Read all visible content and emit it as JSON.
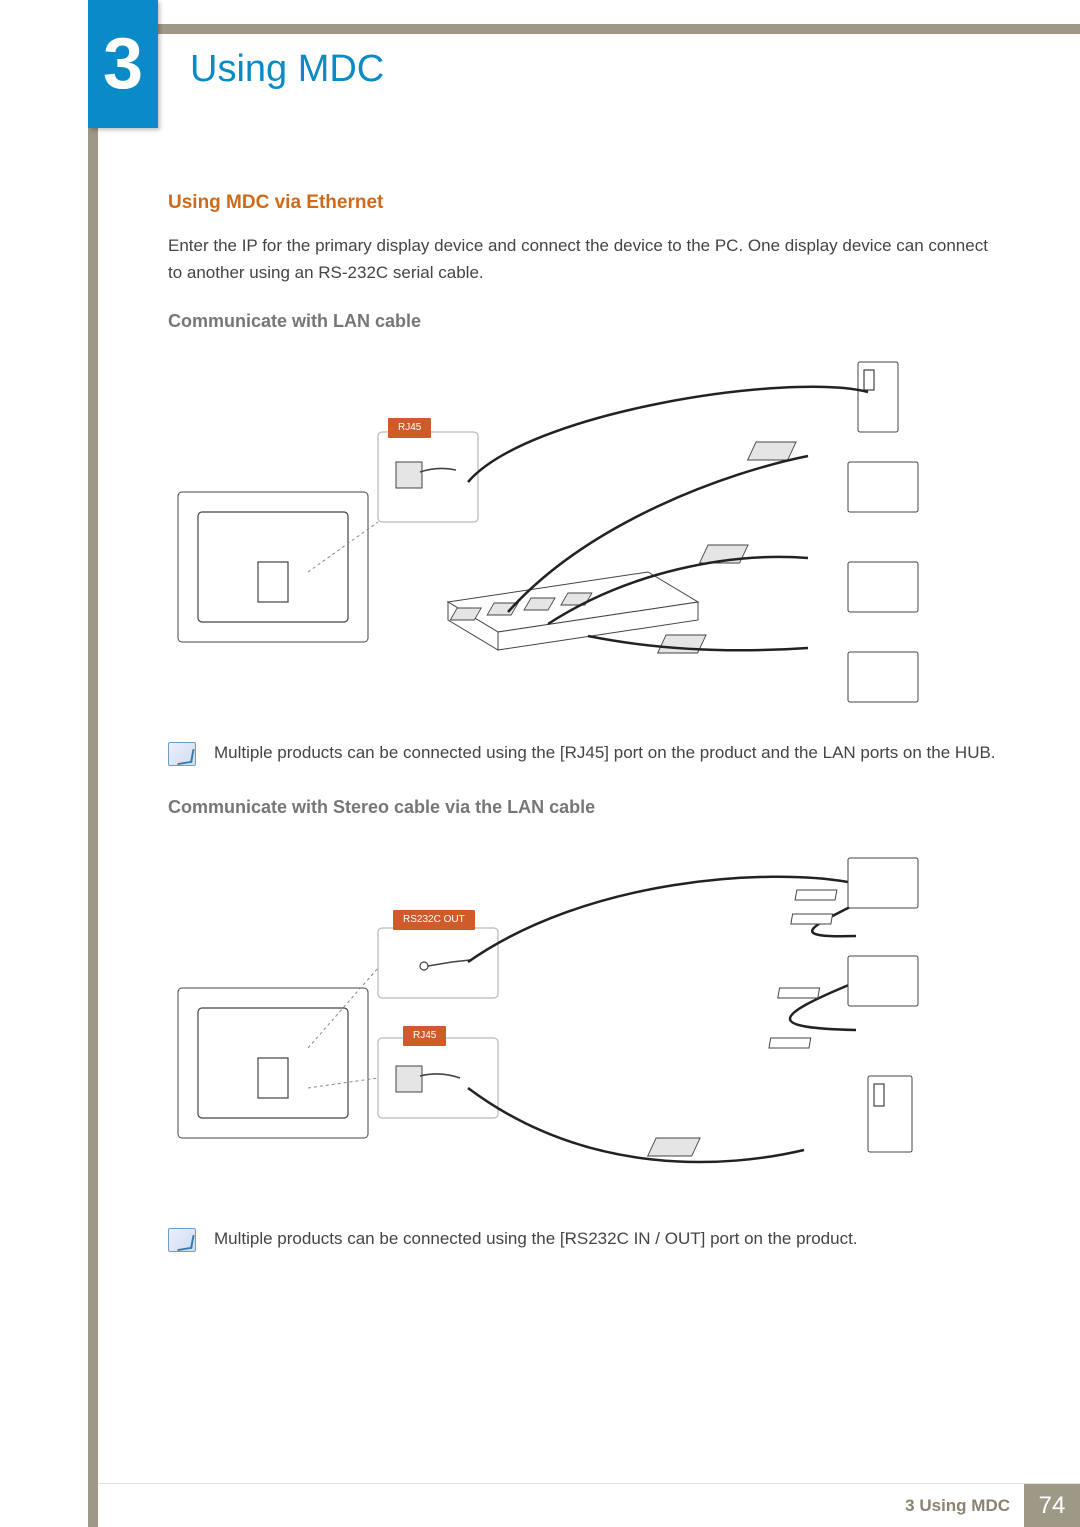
{
  "chapter": {
    "number": "3",
    "title": "Using MDC"
  },
  "section": {
    "heading": "Using MDC via Ethernet",
    "intro": "Enter the IP for the primary display device and connect the device to the PC. One display device can connect to another using an RS-232C serial cable.",
    "sub1": {
      "heading": "Communicate with LAN cable",
      "port_label": "RJ45",
      "note": "Multiple products can be connected using the [RJ45] port on the product and the LAN ports on the HUB."
    },
    "sub2": {
      "heading": "Communicate with Stereo cable via the LAN cable",
      "port_label_top": "RS232C OUT",
      "port_label_bottom": "RJ45",
      "note": "Multiple products can be connected using the [RS232C IN / OUT] port on the product."
    }
  },
  "footer": {
    "label": "3 Using MDC",
    "page": "74"
  }
}
